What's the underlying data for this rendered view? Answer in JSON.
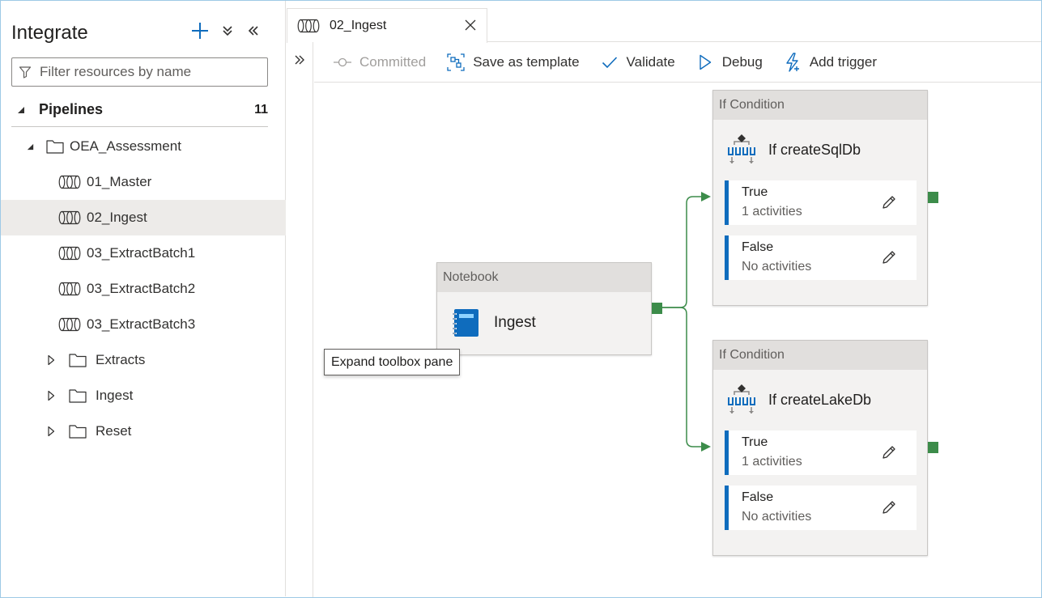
{
  "sidebar": {
    "title": "Integrate",
    "filter_placeholder": "Filter resources by name",
    "pipelines_label": "Pipelines",
    "pipelines_count": "11",
    "folder_oea": "OEA_Assessment",
    "pipelines": [
      "01_Master",
      "02_Ingest",
      "03_ExtractBatch1",
      "03_ExtractBatch2",
      "03_ExtractBatch3"
    ],
    "folders": [
      "Extracts",
      "Ingest",
      "Reset"
    ],
    "selected": "02_Ingest"
  },
  "tab": {
    "label": "02_Ingest"
  },
  "toolbar": {
    "committed": "Committed",
    "save_template": "Save as template",
    "validate": "Validate",
    "debug": "Debug",
    "add_trigger": "Add trigger"
  },
  "canvas": {
    "notebook": {
      "type_label": "Notebook",
      "name": "Ingest"
    },
    "if_conditions": [
      {
        "type_label": "If Condition",
        "name": "If createSqlDb",
        "true_label": "True",
        "true_sub": "1 activities",
        "false_label": "False",
        "false_sub": "No activities"
      },
      {
        "type_label": "If Condition",
        "name": "If createLakeDb",
        "true_label": "True",
        "true_sub": "1 activities",
        "false_label": "False",
        "false_sub": "No activities"
      }
    ],
    "tooltip": "Expand toolbox pane"
  },
  "colors": {
    "accent": "#0f6cbd",
    "success_port": "#3c8c4a",
    "selected_row": "#edebe9"
  }
}
